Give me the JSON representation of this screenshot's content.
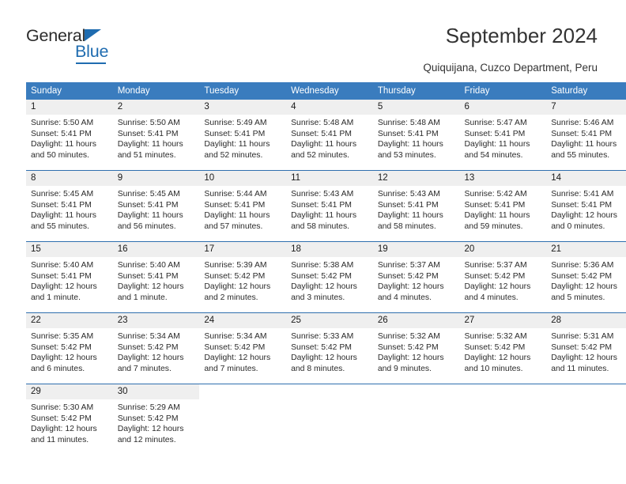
{
  "logo": {
    "text_primary": "General",
    "text_secondary": "Blue",
    "icon": "triangle-icon",
    "accent_color": "#1f6cb0"
  },
  "header": {
    "title": "September 2024",
    "subtitle": "Quiquijana, Cuzco Department, Peru"
  },
  "theme": {
    "header_bg": "#3a7cbe",
    "daynum_bg": "#efefef",
    "week_divider": "#2f6fae",
    "text": "#2a2a2a"
  },
  "calendar": {
    "weekday_headers": [
      "Sunday",
      "Monday",
      "Tuesday",
      "Wednesday",
      "Thursday",
      "Friday",
      "Saturday"
    ],
    "weeks": [
      [
        {
          "day": "1",
          "sunrise": "Sunrise: 5:50 AM",
          "sunset": "Sunset: 5:41 PM",
          "daylight1": "Daylight: 11 hours",
          "daylight2": "and 50 minutes."
        },
        {
          "day": "2",
          "sunrise": "Sunrise: 5:50 AM",
          "sunset": "Sunset: 5:41 PM",
          "daylight1": "Daylight: 11 hours",
          "daylight2": "and 51 minutes."
        },
        {
          "day": "3",
          "sunrise": "Sunrise: 5:49 AM",
          "sunset": "Sunset: 5:41 PM",
          "daylight1": "Daylight: 11 hours",
          "daylight2": "and 52 minutes."
        },
        {
          "day": "4",
          "sunrise": "Sunrise: 5:48 AM",
          "sunset": "Sunset: 5:41 PM",
          "daylight1": "Daylight: 11 hours",
          "daylight2": "and 52 minutes."
        },
        {
          "day": "5",
          "sunrise": "Sunrise: 5:48 AM",
          "sunset": "Sunset: 5:41 PM",
          "daylight1": "Daylight: 11 hours",
          "daylight2": "and 53 minutes."
        },
        {
          "day": "6",
          "sunrise": "Sunrise: 5:47 AM",
          "sunset": "Sunset: 5:41 PM",
          "daylight1": "Daylight: 11 hours",
          "daylight2": "and 54 minutes."
        },
        {
          "day": "7",
          "sunrise": "Sunrise: 5:46 AM",
          "sunset": "Sunset: 5:41 PM",
          "daylight1": "Daylight: 11 hours",
          "daylight2": "and 55 minutes."
        }
      ],
      [
        {
          "day": "8",
          "sunrise": "Sunrise: 5:45 AM",
          "sunset": "Sunset: 5:41 PM",
          "daylight1": "Daylight: 11 hours",
          "daylight2": "and 55 minutes."
        },
        {
          "day": "9",
          "sunrise": "Sunrise: 5:45 AM",
          "sunset": "Sunset: 5:41 PM",
          "daylight1": "Daylight: 11 hours",
          "daylight2": "and 56 minutes."
        },
        {
          "day": "10",
          "sunrise": "Sunrise: 5:44 AM",
          "sunset": "Sunset: 5:41 PM",
          "daylight1": "Daylight: 11 hours",
          "daylight2": "and 57 minutes."
        },
        {
          "day": "11",
          "sunrise": "Sunrise: 5:43 AM",
          "sunset": "Sunset: 5:41 PM",
          "daylight1": "Daylight: 11 hours",
          "daylight2": "and 58 minutes."
        },
        {
          "day": "12",
          "sunrise": "Sunrise: 5:43 AM",
          "sunset": "Sunset: 5:41 PM",
          "daylight1": "Daylight: 11 hours",
          "daylight2": "and 58 minutes."
        },
        {
          "day": "13",
          "sunrise": "Sunrise: 5:42 AM",
          "sunset": "Sunset: 5:41 PM",
          "daylight1": "Daylight: 11 hours",
          "daylight2": "and 59 minutes."
        },
        {
          "day": "14",
          "sunrise": "Sunrise: 5:41 AM",
          "sunset": "Sunset: 5:41 PM",
          "daylight1": "Daylight: 12 hours",
          "daylight2": "and 0 minutes."
        }
      ],
      [
        {
          "day": "15",
          "sunrise": "Sunrise: 5:40 AM",
          "sunset": "Sunset: 5:41 PM",
          "daylight1": "Daylight: 12 hours",
          "daylight2": "and 1 minute."
        },
        {
          "day": "16",
          "sunrise": "Sunrise: 5:40 AM",
          "sunset": "Sunset: 5:41 PM",
          "daylight1": "Daylight: 12 hours",
          "daylight2": "and 1 minute."
        },
        {
          "day": "17",
          "sunrise": "Sunrise: 5:39 AM",
          "sunset": "Sunset: 5:42 PM",
          "daylight1": "Daylight: 12 hours",
          "daylight2": "and 2 minutes."
        },
        {
          "day": "18",
          "sunrise": "Sunrise: 5:38 AM",
          "sunset": "Sunset: 5:42 PM",
          "daylight1": "Daylight: 12 hours",
          "daylight2": "and 3 minutes."
        },
        {
          "day": "19",
          "sunrise": "Sunrise: 5:37 AM",
          "sunset": "Sunset: 5:42 PM",
          "daylight1": "Daylight: 12 hours",
          "daylight2": "and 4 minutes."
        },
        {
          "day": "20",
          "sunrise": "Sunrise: 5:37 AM",
          "sunset": "Sunset: 5:42 PM",
          "daylight1": "Daylight: 12 hours",
          "daylight2": "and 4 minutes."
        },
        {
          "day": "21",
          "sunrise": "Sunrise: 5:36 AM",
          "sunset": "Sunset: 5:42 PM",
          "daylight1": "Daylight: 12 hours",
          "daylight2": "and 5 minutes."
        }
      ],
      [
        {
          "day": "22",
          "sunrise": "Sunrise: 5:35 AM",
          "sunset": "Sunset: 5:42 PM",
          "daylight1": "Daylight: 12 hours",
          "daylight2": "and 6 minutes."
        },
        {
          "day": "23",
          "sunrise": "Sunrise: 5:34 AM",
          "sunset": "Sunset: 5:42 PM",
          "daylight1": "Daylight: 12 hours",
          "daylight2": "and 7 minutes."
        },
        {
          "day": "24",
          "sunrise": "Sunrise: 5:34 AM",
          "sunset": "Sunset: 5:42 PM",
          "daylight1": "Daylight: 12 hours",
          "daylight2": "and 7 minutes."
        },
        {
          "day": "25",
          "sunrise": "Sunrise: 5:33 AM",
          "sunset": "Sunset: 5:42 PM",
          "daylight1": "Daylight: 12 hours",
          "daylight2": "and 8 minutes."
        },
        {
          "day": "26",
          "sunrise": "Sunrise: 5:32 AM",
          "sunset": "Sunset: 5:42 PM",
          "daylight1": "Daylight: 12 hours",
          "daylight2": "and 9 minutes."
        },
        {
          "day": "27",
          "sunrise": "Sunrise: 5:32 AM",
          "sunset": "Sunset: 5:42 PM",
          "daylight1": "Daylight: 12 hours",
          "daylight2": "and 10 minutes."
        },
        {
          "day": "28",
          "sunrise": "Sunrise: 5:31 AM",
          "sunset": "Sunset: 5:42 PM",
          "daylight1": "Daylight: 12 hours",
          "daylight2": "and 11 minutes."
        }
      ],
      [
        {
          "day": "29",
          "sunrise": "Sunrise: 5:30 AM",
          "sunset": "Sunset: 5:42 PM",
          "daylight1": "Daylight: 12 hours",
          "daylight2": "and 11 minutes."
        },
        {
          "day": "30",
          "sunrise": "Sunrise: 5:29 AM",
          "sunset": "Sunset: 5:42 PM",
          "daylight1": "Daylight: 12 hours",
          "daylight2": "and 12 minutes."
        },
        {
          "day": "",
          "sunrise": "",
          "sunset": "",
          "daylight1": "",
          "daylight2": ""
        },
        {
          "day": "",
          "sunrise": "",
          "sunset": "",
          "daylight1": "",
          "daylight2": ""
        },
        {
          "day": "",
          "sunrise": "",
          "sunset": "",
          "daylight1": "",
          "daylight2": ""
        },
        {
          "day": "",
          "sunrise": "",
          "sunset": "",
          "daylight1": "",
          "daylight2": ""
        },
        {
          "day": "",
          "sunrise": "",
          "sunset": "",
          "daylight1": "",
          "daylight2": ""
        }
      ]
    ]
  }
}
